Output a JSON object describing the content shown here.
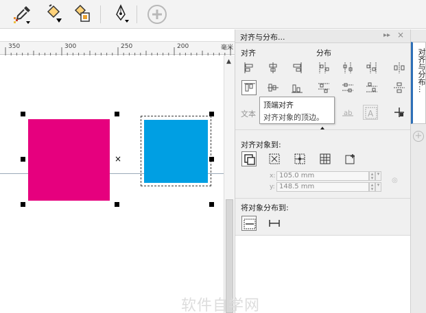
{
  "ruler": {
    "ticks": [
      "350",
      "300",
      "250",
      "200"
    ],
    "unit": "毫米"
  },
  "panel": {
    "title": "对齐与分布...",
    "pin_icon": "▸▸",
    "close_icon": "×",
    "align_label": "对齐",
    "distribute_label": "分布",
    "text_label": "文本",
    "align_to_label": "对齐对象到:",
    "x_label": "x:",
    "x_value": "105.0 mm",
    "y_label": "y:",
    "y_value": "148.5 mm",
    "distribute_to_label": "将对象分布到:"
  },
  "tooltip": {
    "title": "顶端对齐",
    "description": "对齐对象的顶边。"
  },
  "tabstrip": {
    "tab_label": "对齐与分布..."
  },
  "watermark": "软件自学网",
  "colors": {
    "pink_shape": "#e6007e",
    "blue_shape": "#009fe3",
    "accent": "#2d6fb7"
  }
}
